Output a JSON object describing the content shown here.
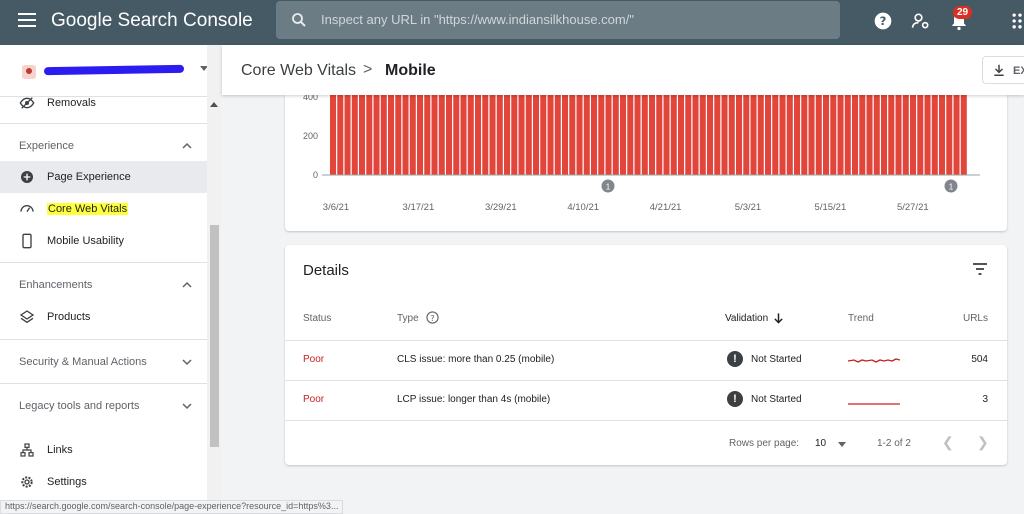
{
  "app": {
    "title": "Google Search Console",
    "search_placeholder": "Inspect any URL in \"https://www.indiansilkhouse.com/\"",
    "notifications_count": "29"
  },
  "header": {
    "breadcrumb_parent": "Core Web Vitals",
    "breadcrumb_separator": ">",
    "breadcrumb_current": "Mobile",
    "export_label": "EX"
  },
  "sidebar": {
    "removals": "Removals",
    "experience_section": "Experience",
    "page_experience": "Page Experience",
    "core_web_vitals": "Core Web Vitals",
    "mobile_usability": "Mobile Usability",
    "enhancements_section": "Enhancements",
    "products": "Products",
    "security_section": "Security & Manual Actions",
    "legacy_section": "Legacy tools and reports",
    "links": "Links",
    "settings": "Settings"
  },
  "chart_data": {
    "type": "bar",
    "y_ticks": [
      "400",
      "200",
      "0"
    ],
    "x_labels": [
      "3/6/21",
      "3/17/21",
      "3/29/21",
      "4/10/21",
      "4/21/21",
      "5/3/21",
      "5/15/21",
      "5/27/21"
    ],
    "annotations": [
      "1",
      "1"
    ],
    "bar_color": "#e2463b",
    "bar_count": 88
  },
  "details": {
    "title": "Details",
    "columns": {
      "status": "Status",
      "type": "Type",
      "validation": "Validation",
      "trend": "Trend",
      "urls": "URLs"
    },
    "rows": [
      {
        "status": "Poor",
        "type": "CLS issue: more than 0.25 (mobile)",
        "validation": "Not Started",
        "urls": "504"
      },
      {
        "status": "Poor",
        "type": "LCP issue: longer than 4s (mobile)",
        "validation": "Not Started",
        "urls": "3"
      }
    ],
    "pager": {
      "rows_per_page_label": "Rows per page:",
      "rows_per_page_value": "10",
      "range": "1-2 of 2"
    }
  },
  "statusbar": "https://search.google.com/search-console/page-experience?resource_id=https%3..."
}
